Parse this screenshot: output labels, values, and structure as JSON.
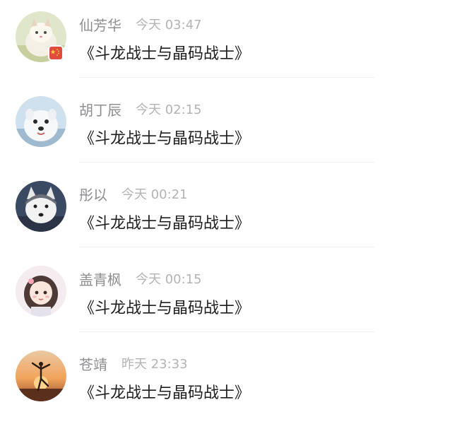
{
  "messages": [
    {
      "name": "仙芳华",
      "time": "今天 03:47",
      "title": "《斗龙战士与晶码战士》",
      "avatar_icon": "cat-avatar-icon",
      "badge_icon": "flag-badge-icon"
    },
    {
      "name": "胡丁辰",
      "time": "今天 02:15",
      "title": "《斗龙战士与晶码战士》",
      "avatar_icon": "white-dog-avatar-icon"
    },
    {
      "name": "彤以",
      "time": "今天 00:21",
      "title": "《斗龙战士与晶码战士》",
      "avatar_icon": "husky-avatar-icon"
    },
    {
      "name": "盖青枫",
      "time": "今天 00:15",
      "title": "《斗龙战士与晶码战士》",
      "avatar_icon": "girl-avatar-icon"
    },
    {
      "name": "苍靖",
      "time": "昨天 23:33",
      "title": "《斗龙战士与晶码战士》",
      "avatar_icon": "dancer-sunset-avatar-icon"
    }
  ],
  "colors": {
    "name_text": "#8e8e93",
    "time_text": "#b3b3b8",
    "title_text": "#1e1e1e",
    "divider": "#f0f0f0",
    "badge": "#e14b3c"
  }
}
